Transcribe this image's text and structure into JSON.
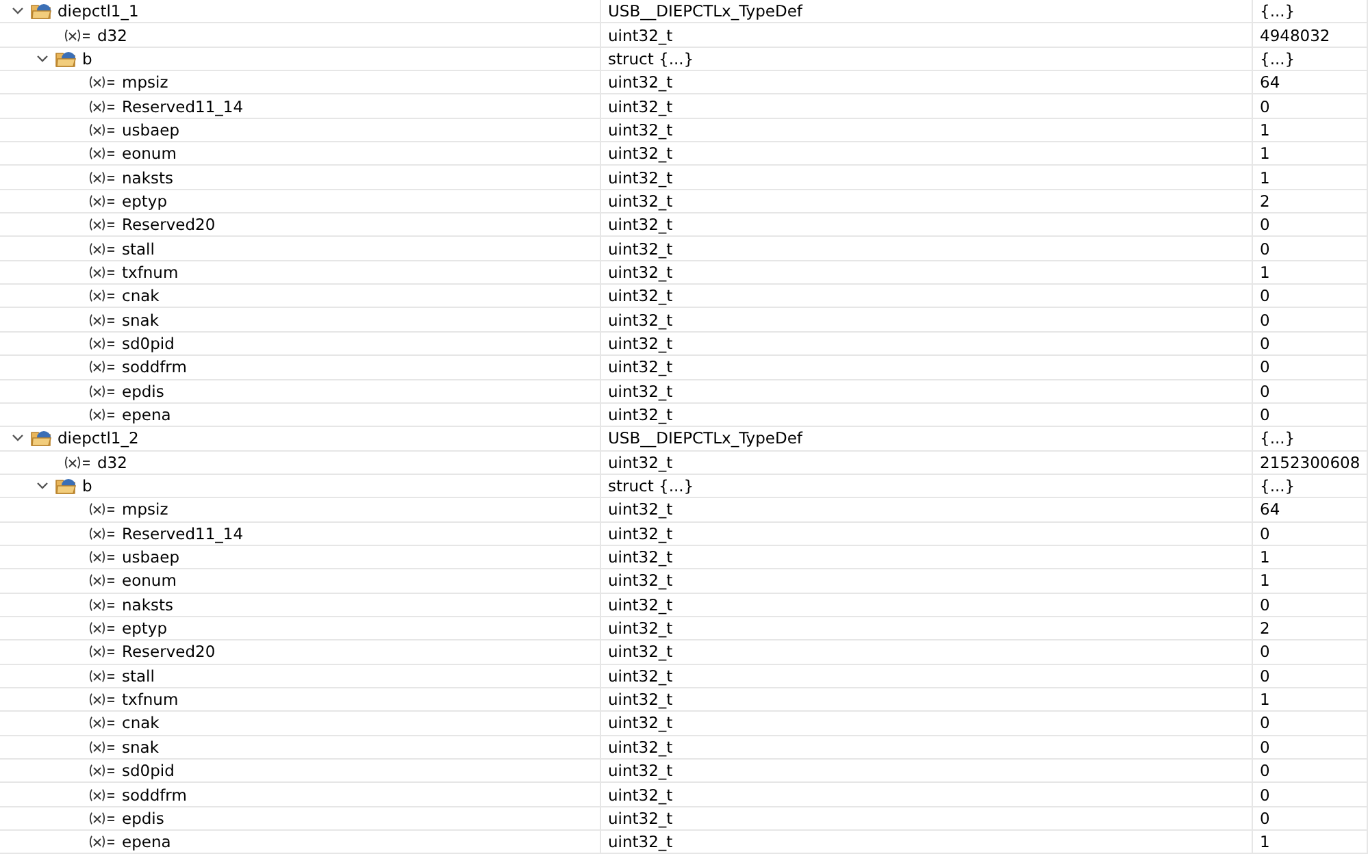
{
  "variables": [
    {
      "name": "diepctl1_1",
      "type": "USB__DIEPCTLx_TypeDef",
      "value": "{...}",
      "kind": "struct",
      "expanded": true,
      "children": [
        {
          "name": "d32",
          "type": "uint32_t",
          "value": "4948032",
          "kind": "field"
        },
        {
          "name": "b",
          "type": "struct {...}",
          "value": "{...}",
          "kind": "struct",
          "expanded": true,
          "children": [
            {
              "name": "mpsiz",
              "type": "uint32_t",
              "value": "64",
              "kind": "field"
            },
            {
              "name": "Reserved11_14",
              "type": "uint32_t",
              "value": "0",
              "kind": "field"
            },
            {
              "name": "usbaep",
              "type": "uint32_t",
              "value": "1",
              "kind": "field"
            },
            {
              "name": "eonum",
              "type": "uint32_t",
              "value": "1",
              "kind": "field"
            },
            {
              "name": "naksts",
              "type": "uint32_t",
              "value": "1",
              "kind": "field"
            },
            {
              "name": "eptyp",
              "type": "uint32_t",
              "value": "2",
              "kind": "field"
            },
            {
              "name": "Reserved20",
              "type": "uint32_t",
              "value": "0",
              "kind": "field"
            },
            {
              "name": "stall",
              "type": "uint32_t",
              "value": "0",
              "kind": "field"
            },
            {
              "name": "txfnum",
              "type": "uint32_t",
              "value": "1",
              "kind": "field"
            },
            {
              "name": "cnak",
              "type": "uint32_t",
              "value": "0",
              "kind": "field"
            },
            {
              "name": "snak",
              "type": "uint32_t",
              "value": "0",
              "kind": "field"
            },
            {
              "name": "sd0pid",
              "type": "uint32_t",
              "value": "0",
              "kind": "field"
            },
            {
              "name": "soddfrm",
              "type": "uint32_t",
              "value": "0",
              "kind": "field"
            },
            {
              "name": "epdis",
              "type": "uint32_t",
              "value": "0",
              "kind": "field"
            },
            {
              "name": "epena",
              "type": "uint32_t",
              "value": "0",
              "kind": "field"
            }
          ]
        }
      ]
    },
    {
      "name": "diepctl1_2",
      "type": "USB__DIEPCTLx_TypeDef",
      "value": "{...}",
      "kind": "struct",
      "expanded": true,
      "children": [
        {
          "name": "d32",
          "type": "uint32_t",
          "value": "2152300608",
          "kind": "field"
        },
        {
          "name": "b",
          "type": "struct {...}",
          "value": "{...}",
          "kind": "struct",
          "expanded": true,
          "children": [
            {
              "name": "mpsiz",
              "type": "uint32_t",
              "value": "64",
              "kind": "field"
            },
            {
              "name": "Reserved11_14",
              "type": "uint32_t",
              "value": "0",
              "kind": "field"
            },
            {
              "name": "usbaep",
              "type": "uint32_t",
              "value": "1",
              "kind": "field"
            },
            {
              "name": "eonum",
              "type": "uint32_t",
              "value": "1",
              "kind": "field"
            },
            {
              "name": "naksts",
              "type": "uint32_t",
              "value": "0",
              "kind": "field"
            },
            {
              "name": "eptyp",
              "type": "uint32_t",
              "value": "2",
              "kind": "field"
            },
            {
              "name": "Reserved20",
              "type": "uint32_t",
              "value": "0",
              "kind": "field"
            },
            {
              "name": "stall",
              "type": "uint32_t",
              "value": "0",
              "kind": "field"
            },
            {
              "name": "txfnum",
              "type": "uint32_t",
              "value": "1",
              "kind": "field"
            },
            {
              "name": "cnak",
              "type": "uint32_t",
              "value": "0",
              "kind": "field"
            },
            {
              "name": "snak",
              "type": "uint32_t",
              "value": "0",
              "kind": "field"
            },
            {
              "name": "sd0pid",
              "type": "uint32_t",
              "value": "0",
              "kind": "field"
            },
            {
              "name": "soddfrm",
              "type": "uint32_t",
              "value": "0",
              "kind": "field"
            },
            {
              "name": "epdis",
              "type": "uint32_t",
              "value": "0",
              "kind": "field"
            },
            {
              "name": "epena",
              "type": "uint32_t",
              "value": "1",
              "kind": "field"
            }
          ]
        }
      ]
    }
  ]
}
